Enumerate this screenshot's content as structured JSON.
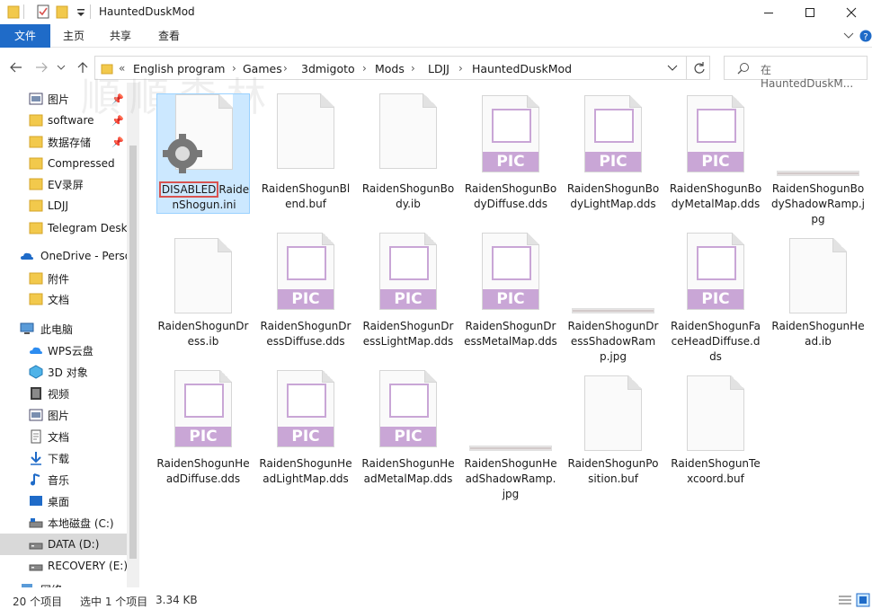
{
  "window": {
    "title": "HauntedDuskMod"
  },
  "ribbon": {
    "tabs": [
      "文件",
      "主页",
      "共享",
      "查看"
    ]
  },
  "address": {
    "overflow": "«",
    "crumbs": [
      "English program",
      "Games",
      "3dmigoto",
      "Mods",
      "LDJJ",
      "HauntedDuskMod"
    ],
    "search_placeholder": "在 HauntedDuskM..."
  },
  "sidebar": {
    "items": [
      {
        "label": "图片",
        "icon": "pictures-icon",
        "pinned": true
      },
      {
        "label": "software",
        "icon": "folder-icon",
        "pinned": true
      },
      {
        "label": "数据存储",
        "icon": "folder-icon",
        "pinned": true
      },
      {
        "label": "Compressed",
        "icon": "folder-icon"
      },
      {
        "label": "EV录屏",
        "icon": "folder-icon"
      },
      {
        "label": "LDJJ",
        "icon": "folder-icon"
      },
      {
        "label": "Telegram Desk",
        "icon": "folder-icon"
      },
      {
        "label": "OneDrive - Perso",
        "icon": "onedrive-icon"
      },
      {
        "label": "附件",
        "icon": "folder-icon"
      },
      {
        "label": "文档",
        "icon": "folder-icon"
      },
      {
        "label": "此电脑",
        "icon": "this-pc-icon"
      },
      {
        "label": "WPS云盘",
        "icon": "wps-cloud-icon"
      },
      {
        "label": "3D 对象",
        "icon": "3d-objects-icon"
      },
      {
        "label": "视频",
        "icon": "videos-icon"
      },
      {
        "label": "图片",
        "icon": "pictures-icon"
      },
      {
        "label": "文档",
        "icon": "documents-icon"
      },
      {
        "label": "下载",
        "icon": "downloads-icon"
      },
      {
        "label": "音乐",
        "icon": "music-icon"
      },
      {
        "label": "桌面",
        "icon": "desktop-icon"
      },
      {
        "label": "本地磁盘 (C:)",
        "icon": "drive-icon"
      },
      {
        "label": "DATA (D:)",
        "icon": "drive-icon",
        "selected": true
      },
      {
        "label": "RECOVERY (E:)",
        "icon": "drive-icon"
      },
      {
        "label": "网络",
        "icon": "network-icon"
      }
    ]
  },
  "files": [
    {
      "name_prefix": "DISABLED",
      "name": "RaidenShogun.ini",
      "type": "ini",
      "selected": true
    },
    {
      "name": "RaidenShogunBlend.buf",
      "type": "doc"
    },
    {
      "name": "RaidenShogunBody.ib",
      "type": "doc"
    },
    {
      "name": "RaidenShogunBodyDiffuse.dds",
      "type": "pic"
    },
    {
      "name": "RaidenShogunBodyLightMap.dds",
      "type": "pic"
    },
    {
      "name": "RaidenShogunBodyMetalMap.dds",
      "type": "pic"
    },
    {
      "name": "RaidenShogunBodyShadowRamp.jpg",
      "type": "strip"
    },
    {
      "name": "RaidenShogunDress.ib",
      "type": "doc"
    },
    {
      "name": "RaidenShogunDressDiffuse.dds",
      "type": "pic"
    },
    {
      "name": "RaidenShogunDressLightMap.dds",
      "type": "pic"
    },
    {
      "name": "RaidenShogunDressMetalMap.dds",
      "type": "pic"
    },
    {
      "name": "RaidenShogunDressShadowRamp.jpg",
      "type": "strip"
    },
    {
      "name": "RaidenShogunFaceHeadDiffuse.dds",
      "type": "pic"
    },
    {
      "name": "RaidenShogunHead.ib",
      "type": "doc"
    },
    {
      "name": "RaidenShogunHeadDiffuse.dds",
      "type": "pic"
    },
    {
      "name": "RaidenShogunHeadLightMap.dds",
      "type": "pic"
    },
    {
      "name": "RaidenShogunHeadMetalMap.dds",
      "type": "pic"
    },
    {
      "name": "RaidenShogunHeadShadowRamp.jpg",
      "type": "strip"
    },
    {
      "name": "RaidenShogunPosition.buf",
      "type": "doc"
    },
    {
      "name": "RaidenShogunTexcoord.buf",
      "type": "doc"
    }
  ],
  "pic_label": "PIC",
  "status": {
    "count": "20 个项目",
    "selected": "选中 1 个项目",
    "size": "3.34 KB"
  },
  "colors": {
    "accent": "#1f6bc8",
    "selection": "#cce8ff",
    "pic": "#c9a6d6",
    "highlight": "#d9534f"
  }
}
